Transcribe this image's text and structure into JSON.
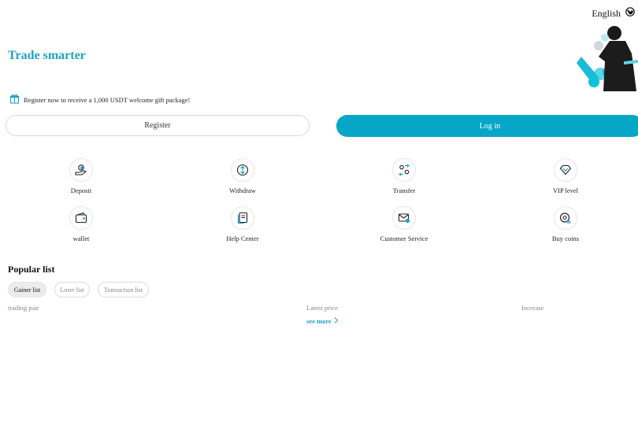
{
  "header": {
    "language_label": "English",
    "language_icon": "globe-icon"
  },
  "hero": {
    "title": "Trade smarter",
    "art": "trader-illustration"
  },
  "promo": {
    "icon": "gift-icon",
    "text": "Register now to receive a 1,000 USDT welcome gift package!"
  },
  "auth": {
    "register_label": "Register",
    "login_label": "Log in"
  },
  "actions": [
    {
      "label": "Deposit",
      "icon": "deposit-icon"
    },
    {
      "label": "Withdraw",
      "icon": "withdraw-icon"
    },
    {
      "label": "Transfer",
      "icon": "transfer-icon"
    },
    {
      "label": "VIP level",
      "icon": "vip-icon"
    },
    {
      "label": "wallet",
      "icon": "wallet-icon"
    },
    {
      "label": "Help Center",
      "icon": "help-center-icon"
    },
    {
      "label": "Customer Service",
      "icon": "customer-service-icon"
    },
    {
      "label": "Buy coins",
      "icon": "buy-coins-icon"
    }
  ],
  "popular": {
    "title": "Popular list",
    "tabs": [
      {
        "label": "Gainer list",
        "active": true
      },
      {
        "label": "Loser list",
        "active": false
      },
      {
        "label": "Transaction list",
        "active": false
      }
    ],
    "columns": [
      "trading pair",
      "Latest price",
      "Increase"
    ],
    "see_more_label": "see more"
  },
  "colors": {
    "accent": "#1ea4c6",
    "button": "#06a6c7"
  }
}
